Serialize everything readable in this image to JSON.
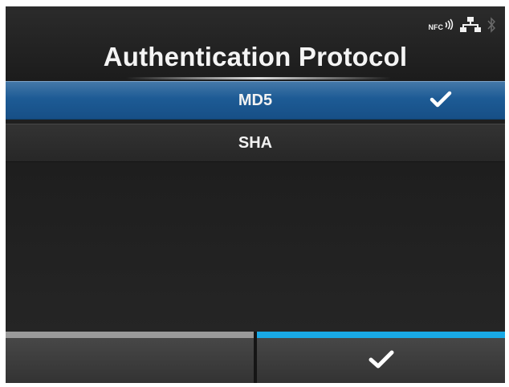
{
  "screen": {
    "title": "Authentication Protocol"
  },
  "status_icons": {
    "nfc_label": "NFC",
    "icons": [
      "nfc-icon",
      "wired-network-icon",
      "bluetooth-icon"
    ]
  },
  "options": [
    {
      "label": "MD5",
      "selected": true
    },
    {
      "label": "SHA",
      "selected": false
    }
  ],
  "softkeys": {
    "left": {
      "label": "",
      "indicator_color": "#9a9a9a"
    },
    "right": {
      "icon": "check-icon",
      "indicator_color": "#19a9e6"
    }
  },
  "colors": {
    "selected_row": "#1d5b95",
    "background": "#1f1f1f",
    "accent": "#19a9e6"
  }
}
